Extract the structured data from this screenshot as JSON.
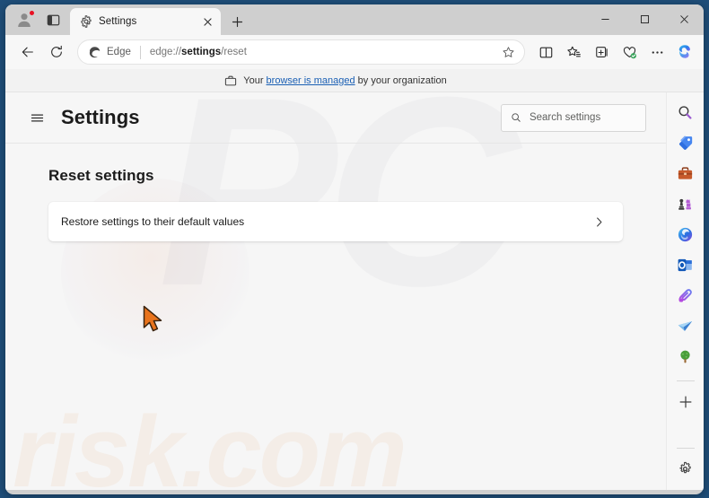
{
  "window": {
    "minimize_label": "Minimize",
    "maximize_label": "Maximize",
    "close_label": "Close"
  },
  "titlebar": {
    "profile_label": "Profile",
    "tab_actions_label": "Tab actions menu",
    "new_tab_label": "New tab"
  },
  "tabs": [
    {
      "title": "Settings",
      "favicon": "gear-icon",
      "close_label": "Close tab",
      "active": true
    }
  ],
  "navbar": {
    "back_label": "Back",
    "refresh_label": "Refresh",
    "edge_badge_label": "Edge",
    "url_prefix": "edge://",
    "url_bold": "settings",
    "url_suffix": "/reset",
    "favorite_label": "Add this page to favorites",
    "split_screen_label": "Split screen",
    "favorites_label": "Favorites",
    "collections_label": "Collections",
    "browser_essentials_label": "Browser essentials",
    "settings_more_label": "Settings and more",
    "copilot_label": "Copilot"
  },
  "managed_banner": {
    "icon": "briefcase-icon",
    "text_before": "Your ",
    "link_text": "browser is managed",
    "text_after": " by your organization"
  },
  "settings_page": {
    "menu_label": "Settings menu",
    "title": "Settings",
    "search_placeholder": "Search settings",
    "search_value": "",
    "search_icon": "search-icon"
  },
  "main": {
    "heading": "Reset settings",
    "rows": [
      {
        "label": "Restore settings to their default values",
        "chevron": "chevron-right-icon"
      }
    ]
  },
  "sidebar": {
    "items": [
      {
        "name": "search",
        "icon": "search-icon",
        "label": "Search"
      },
      {
        "name": "shopping",
        "icon": "price-tag-icon",
        "label": "Shopping"
      },
      {
        "name": "tools",
        "icon": "briefcase-icon",
        "label": "Tools"
      },
      {
        "name": "games",
        "icon": "chess-icon",
        "label": "Games"
      },
      {
        "name": "copilot",
        "icon": "copilot-icon",
        "label": "Copilot"
      },
      {
        "name": "outlook",
        "icon": "outlook-icon",
        "label": "Outlook"
      },
      {
        "name": "designer",
        "icon": "designer-icon",
        "label": "Designer"
      },
      {
        "name": "deals",
        "icon": "paper-plane-icon",
        "label": "Deals"
      },
      {
        "name": "nature",
        "icon": "tree-icon",
        "label": "Drop"
      }
    ],
    "customize_label": "Customize sidebar",
    "settings_label": "Sidebar settings"
  },
  "watermark": {
    "logo": "PC",
    "domain": "risk.com"
  },
  "colors": {
    "accent_blue": "#1a5fb4",
    "desktop": "#1f4e79",
    "cursor": "#e8731c",
    "notification_dot": "#e81123"
  }
}
